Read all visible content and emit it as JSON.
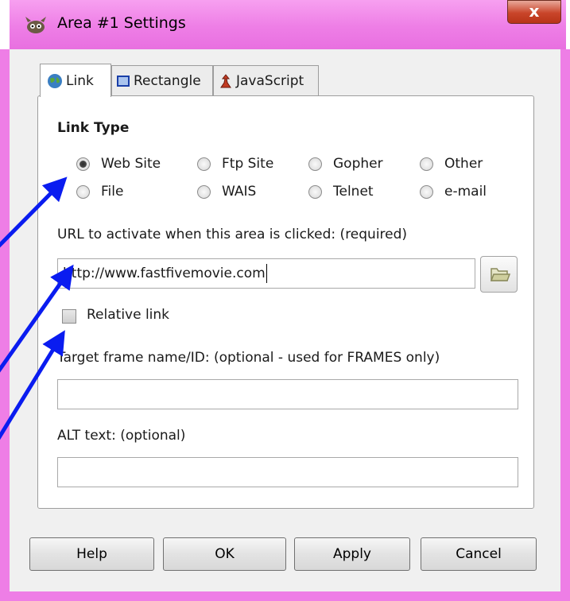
{
  "window": {
    "title": "Area #1 Settings",
    "close_label": "x"
  },
  "tabs": [
    {
      "label": "Link",
      "active": true
    },
    {
      "label": "Rectangle",
      "active": false
    },
    {
      "label": "JavaScript",
      "active": false
    }
  ],
  "link_type": {
    "heading": "Link Type",
    "options": [
      {
        "label": "Web Site",
        "checked": true
      },
      {
        "label": "Ftp Site",
        "checked": false
      },
      {
        "label": "Gopher",
        "checked": false
      },
      {
        "label": "Other",
        "checked": false
      },
      {
        "label": "File",
        "checked": false
      },
      {
        "label": "WAIS",
        "checked": false
      },
      {
        "label": "Telnet",
        "checked": false
      },
      {
        "label": "e-mail",
        "checked": false
      }
    ]
  },
  "url": {
    "label": "URL to activate when this area is clicked: (required)",
    "value": "http://www.fastfivemovie.com"
  },
  "relative_link": {
    "label": "Relative link",
    "checked": false
  },
  "target_frame": {
    "label": "Target frame name/ID: (optional - used for FRAMES only)",
    "value": ""
  },
  "alt_text": {
    "label": "ALT text: (optional)",
    "value": ""
  },
  "buttons": {
    "help": "Help",
    "ok": "OK",
    "apply": "Apply",
    "cancel": "Cancel"
  },
  "colors": {
    "title_bar": "#ee7ee6",
    "arrow": "#0a1cf0",
    "close": "#c9452a"
  }
}
